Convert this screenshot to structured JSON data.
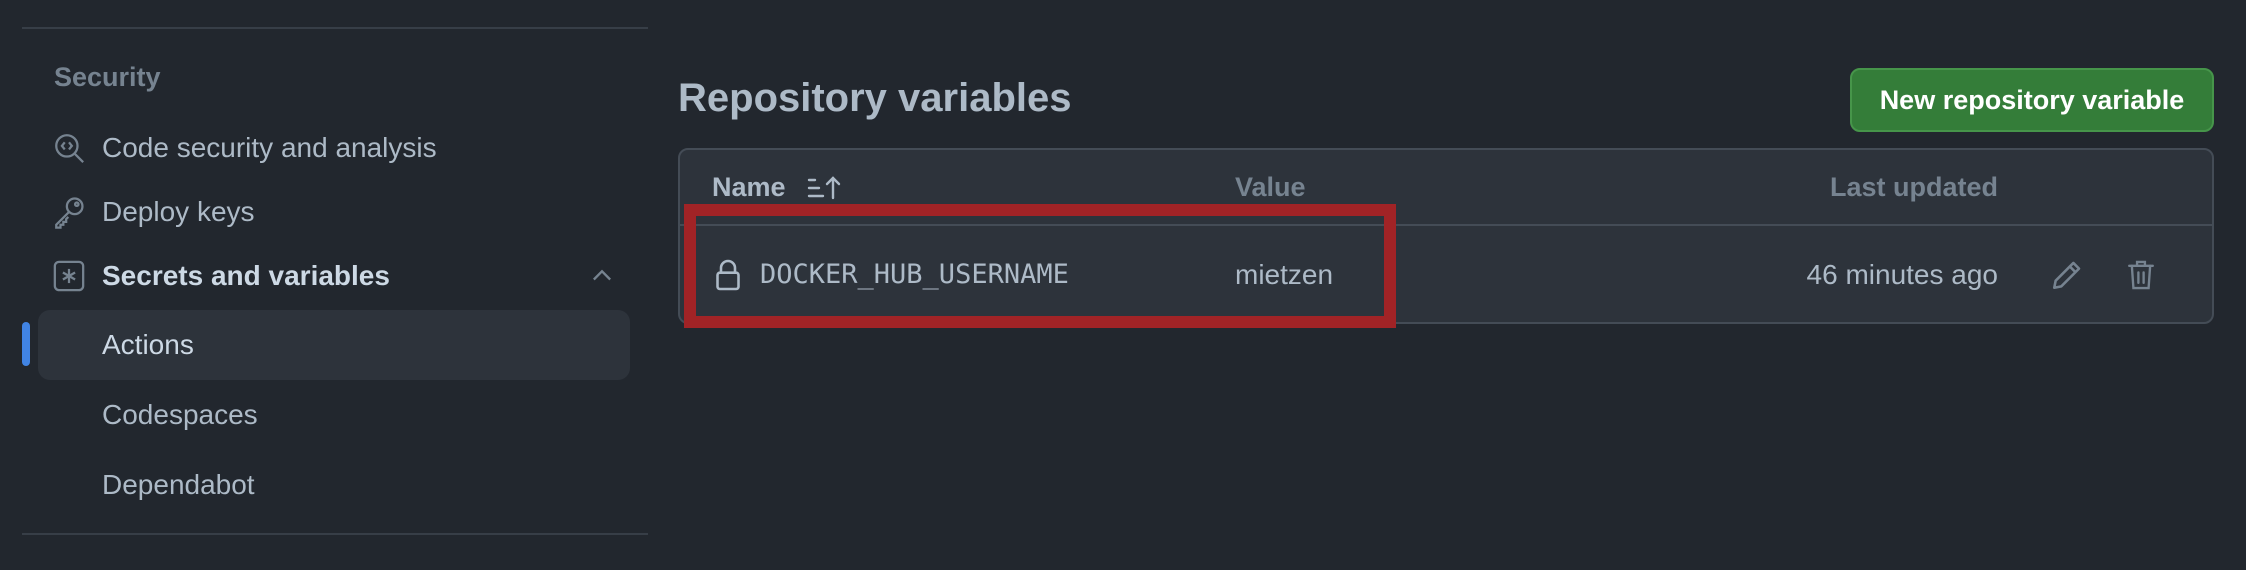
{
  "sidebar": {
    "section_heading": "Security",
    "items": [
      {
        "label": "Code security and analysis",
        "icon": "codescan-icon"
      },
      {
        "label": "Deploy keys",
        "icon": "key-icon"
      },
      {
        "label": "Secrets and variables",
        "icon": "asterisk-icon",
        "expanded": true
      },
      {
        "label": "Actions",
        "active": true
      },
      {
        "label": "Codespaces"
      },
      {
        "label": "Dependabot"
      }
    ]
  },
  "main": {
    "title": "Repository variables",
    "new_button_label": "New repository variable",
    "table": {
      "columns": {
        "name": "Name",
        "value": "Value",
        "updated": "Last updated"
      },
      "rows": [
        {
          "name": "DOCKER_HUB_USERNAME",
          "value": "mietzen",
          "updated": "46 minutes ago"
        }
      ]
    }
  },
  "colors": {
    "background": "#22272e",
    "accent_active": "#4184e4",
    "button_green": "#347d39",
    "highlight_red": "#a12326"
  }
}
